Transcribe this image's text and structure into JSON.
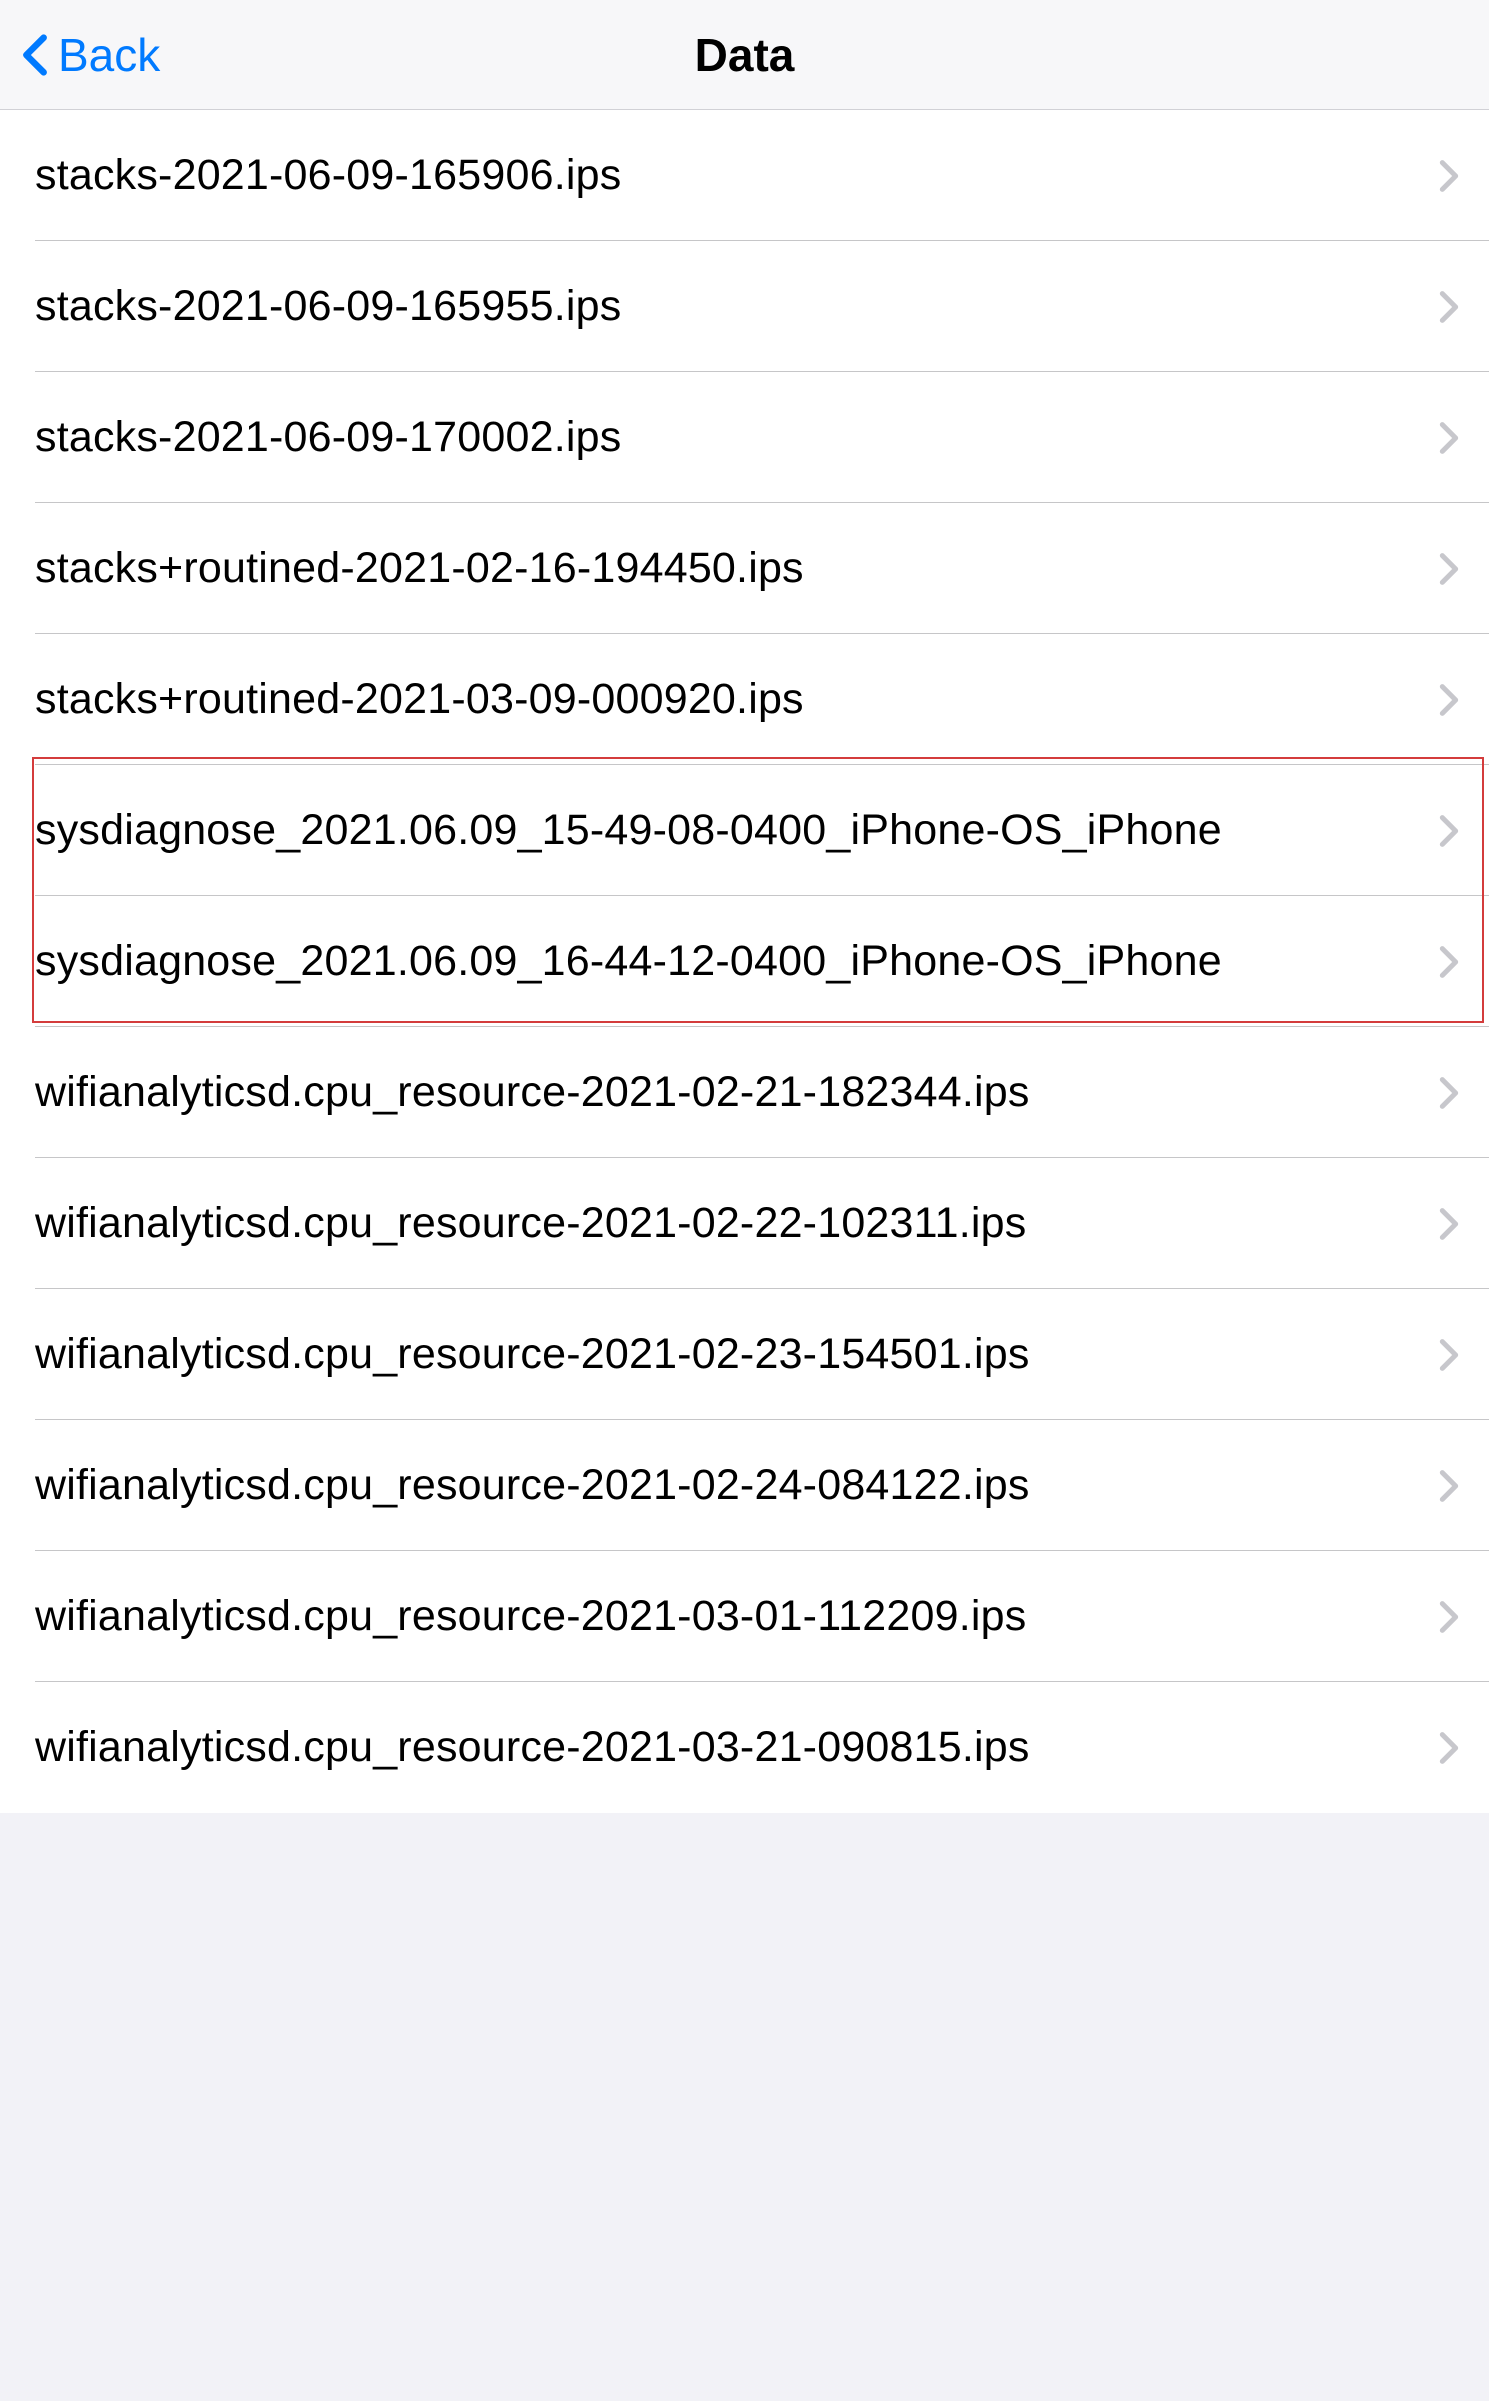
{
  "nav": {
    "back_label": "Back",
    "title": "Data"
  },
  "highlight": {
    "start_index": 5,
    "end_index": 6
  },
  "items": [
    {
      "label": "stacks-2021-06-09-165906.ips"
    },
    {
      "label": "stacks-2021-06-09-165955.ips"
    },
    {
      "label": "stacks-2021-06-09-170002.ips"
    },
    {
      "label": "stacks+routined-2021-02-16-194450.ips"
    },
    {
      "label": "stacks+routined-2021-03-09-000920.ips"
    },
    {
      "label": "sysdiagnose_2021.06.09_15-49-08-0400_iPhone-OS_iPhone"
    },
    {
      "label": "sysdiagnose_2021.06.09_16-44-12-0400_iPhone-OS_iPhone"
    },
    {
      "label": "wifianalyticsd.cpu_resource-2021-02-21-182344.ips"
    },
    {
      "label": "wifianalyticsd.cpu_resource-2021-02-22-102311.ips"
    },
    {
      "label": "wifianalyticsd.cpu_resource-2021-02-23-154501.ips"
    },
    {
      "label": "wifianalyticsd.cpu_resource-2021-02-24-084122.ips"
    },
    {
      "label": "wifianalyticsd.cpu_resource-2021-03-01-112209.ips"
    },
    {
      "label": "wifianalyticsd.cpu_resource-2021-03-21-090815.ips"
    }
  ]
}
